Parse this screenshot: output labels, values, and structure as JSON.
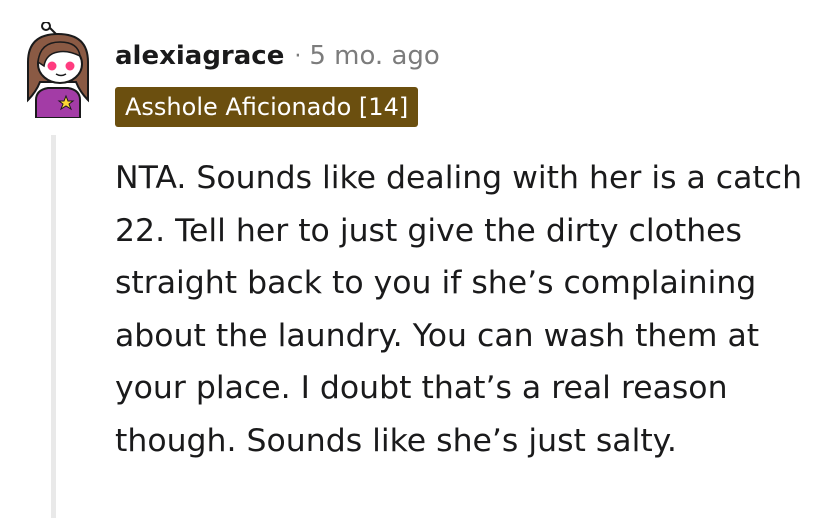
{
  "comment": {
    "author": "alexiagrace",
    "separator": "·",
    "timestamp": "5 mo. ago",
    "flair": "Asshole Aficionado [14]",
    "body": "NTA. Sounds like dealing with her is a catch 22. Tell her to just give the dirty clothes straight back to you if she’s complaining about the laundry. You can wash them at your place. I doubt that’s a real reason though. Sounds like she’s just salty."
  },
  "colors": {
    "flair_background": "#6b4f0f",
    "flair_text": "#ffffff",
    "muted_text": "#7c7c7c",
    "body_text": "#1a1a1b",
    "thread_line": "#e9e9e9"
  },
  "icons": {
    "avatar": "snoo-avatar-icon"
  }
}
